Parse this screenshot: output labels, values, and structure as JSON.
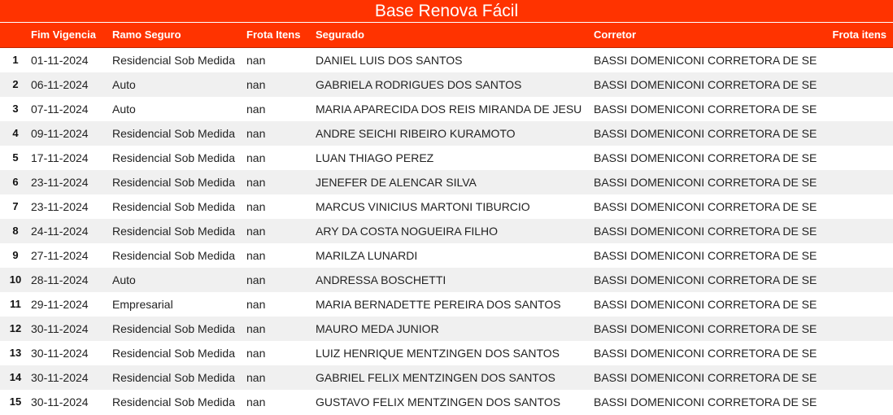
{
  "title": "Base Renova Fácil",
  "colors": {
    "header_bg": "#ff3300",
    "header_text": "#ffffff",
    "row_alt": "#f0f0f0"
  },
  "columns": [
    "",
    "Fim Vigencia",
    "Ramo Seguro",
    "Frota Itens",
    "Segurado",
    "Corretor",
    "Frota itens"
  ],
  "rows": [
    {
      "idx": "1",
      "fim": "01-11-2024",
      "ramo": "Residencial Sob Medida",
      "frota": "nan",
      "segurado": "DANIEL LUIS DOS SANTOS",
      "corretor": "BASSI DOMENICONI CORRETORA DE SE",
      "frota2": ""
    },
    {
      "idx": "2",
      "fim": "06-11-2024",
      "ramo": "Auto",
      "frota": "nan",
      "segurado": "GABRIELA RODRIGUES DOS SANTOS",
      "corretor": "BASSI DOMENICONI CORRETORA DE SE",
      "frota2": ""
    },
    {
      "idx": "3",
      "fim": "07-11-2024",
      "ramo": "Auto",
      "frota": "nan",
      "segurado": "MARIA APARECIDA DOS REIS MIRANDA DE JESU",
      "corretor": "BASSI DOMENICONI CORRETORA DE SE",
      "frota2": ""
    },
    {
      "idx": "4",
      "fim": "09-11-2024",
      "ramo": "Residencial Sob Medida",
      "frota": "nan",
      "segurado": "ANDRE SEICHI RIBEIRO KURAMOTO",
      "corretor": "BASSI DOMENICONI CORRETORA DE SE",
      "frota2": ""
    },
    {
      "idx": "5",
      "fim": "17-11-2024",
      "ramo": "Residencial Sob Medida",
      "frota": "nan",
      "segurado": "LUAN THIAGO PEREZ",
      "corretor": "BASSI DOMENICONI CORRETORA DE SE",
      "frota2": ""
    },
    {
      "idx": "6",
      "fim": "23-11-2024",
      "ramo": "Residencial Sob Medida",
      "frota": "nan",
      "segurado": "JENEFER DE ALENCAR SILVA",
      "corretor": "BASSI DOMENICONI CORRETORA DE SE",
      "frota2": ""
    },
    {
      "idx": "7",
      "fim": "23-11-2024",
      "ramo": "Residencial Sob Medida",
      "frota": "nan",
      "segurado": "MARCUS VINICIUS MARTONI TIBURCIO",
      "corretor": "BASSI DOMENICONI CORRETORA DE SE",
      "frota2": ""
    },
    {
      "idx": "8",
      "fim": "24-11-2024",
      "ramo": "Residencial Sob Medida",
      "frota": "nan",
      "segurado": "ARY DA COSTA NOGUEIRA FILHO",
      "corretor": "BASSI DOMENICONI CORRETORA DE SE",
      "frota2": ""
    },
    {
      "idx": "9",
      "fim": "27-11-2024",
      "ramo": "Residencial Sob Medida",
      "frota": "nan",
      "segurado": "MARILZA LUNARDI",
      "corretor": "BASSI DOMENICONI CORRETORA DE SE",
      "frota2": ""
    },
    {
      "idx": "10",
      "fim": "28-11-2024",
      "ramo": "Auto",
      "frota": "nan",
      "segurado": "ANDRESSA BOSCHETTI",
      "corretor": "BASSI DOMENICONI CORRETORA DE SE",
      "frota2": ""
    },
    {
      "idx": "11",
      "fim": "29-11-2024",
      "ramo": "Empresarial",
      "frota": "nan",
      "segurado": "MARIA BERNADETTE PEREIRA DOS SANTOS",
      "corretor": "BASSI DOMENICONI CORRETORA DE SE",
      "frota2": ""
    },
    {
      "idx": "12",
      "fim": "30-11-2024",
      "ramo": "Residencial Sob Medida",
      "frota": "nan",
      "segurado": "MAURO MEDA JUNIOR",
      "corretor": "BASSI DOMENICONI CORRETORA DE SE",
      "frota2": ""
    },
    {
      "idx": "13",
      "fim": "30-11-2024",
      "ramo": "Residencial Sob Medida",
      "frota": "nan",
      "segurado": "LUIZ HENRIQUE MENTZINGEN DOS SANTOS",
      "corretor": "BASSI DOMENICONI CORRETORA DE SE",
      "frota2": ""
    },
    {
      "idx": "14",
      "fim": "30-11-2024",
      "ramo": "Residencial Sob Medida",
      "frota": "nan",
      "segurado": "GABRIEL FELIX MENTZINGEN DOS SANTOS",
      "corretor": "BASSI DOMENICONI CORRETORA DE SE",
      "frota2": ""
    },
    {
      "idx": "15",
      "fim": "30-11-2024",
      "ramo": "Residencial Sob Medida",
      "frota": "nan",
      "segurado": "GUSTAVO FELIX MENTZINGEN DOS SANTOS",
      "corretor": "BASSI DOMENICONI CORRETORA DE SE",
      "frota2": ""
    }
  ]
}
